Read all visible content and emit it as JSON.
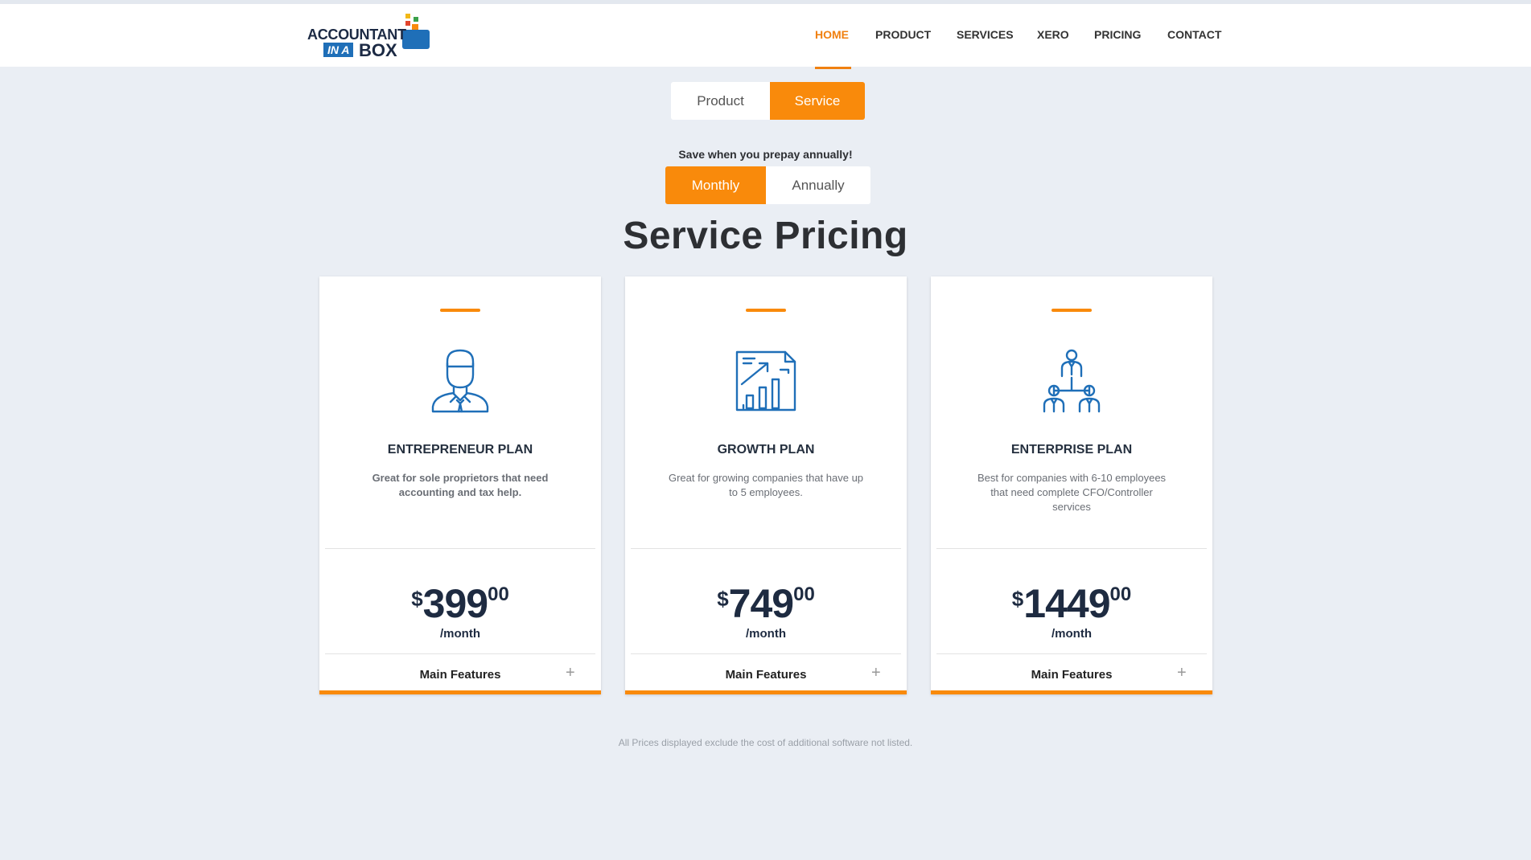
{
  "logo": {
    "line1": "ACCOUNTANT",
    "ina": "IN A",
    "box": "BOX"
  },
  "nav": {
    "items": [
      {
        "label": "HOME",
        "active": true
      },
      {
        "label": "PRODUCT"
      },
      {
        "label": "SERVICES"
      },
      {
        "label": "XERO"
      },
      {
        "label": "PRICING"
      },
      {
        "label": "CONTACT"
      }
    ]
  },
  "type_toggle": {
    "product": "Product",
    "service": "Service",
    "selected": "Service"
  },
  "save_note": "Save when you prepay annually!",
  "billing_toggle": {
    "monthly": "Monthly",
    "annually": "Annually",
    "selected": "Monthly"
  },
  "page_title": "Service Pricing",
  "plans": [
    {
      "icon": "person-icon",
      "name": "ENTREPRENEUR PLAN",
      "description": "Great for sole proprietors that need accounting and tax help.",
      "currency": "$",
      "amount": "399",
      "cents": "00",
      "period": "/month",
      "features_label": "Main Features",
      "expand_icon": "plus-icon"
    },
    {
      "icon": "growth-chart-icon",
      "name": "GROWTH PLAN",
      "description": "Great for growing companies that have up to 5 employees.",
      "currency": "$",
      "amount": "749",
      "cents": "00",
      "period": "/month",
      "features_label": "Main Features",
      "expand_icon": "plus-icon"
    },
    {
      "icon": "org-team-icon",
      "name": "ENTERPRISE PLAN",
      "description": "Best for companies with 6-10 employees that need complete CFO/Controller services",
      "currency": "$",
      "amount": "1449",
      "cents": "00",
      "period": "/month",
      "features_label": "Main Features",
      "expand_icon": "plus-icon"
    }
  ],
  "footnote": "All Prices displayed exclude the cost of additional software not listed.",
  "colors": {
    "accent": "#f98a0b",
    "background": "#eaeef4",
    "icon_blue": "#1f6fb8",
    "dark_text": "#1e2b41"
  }
}
